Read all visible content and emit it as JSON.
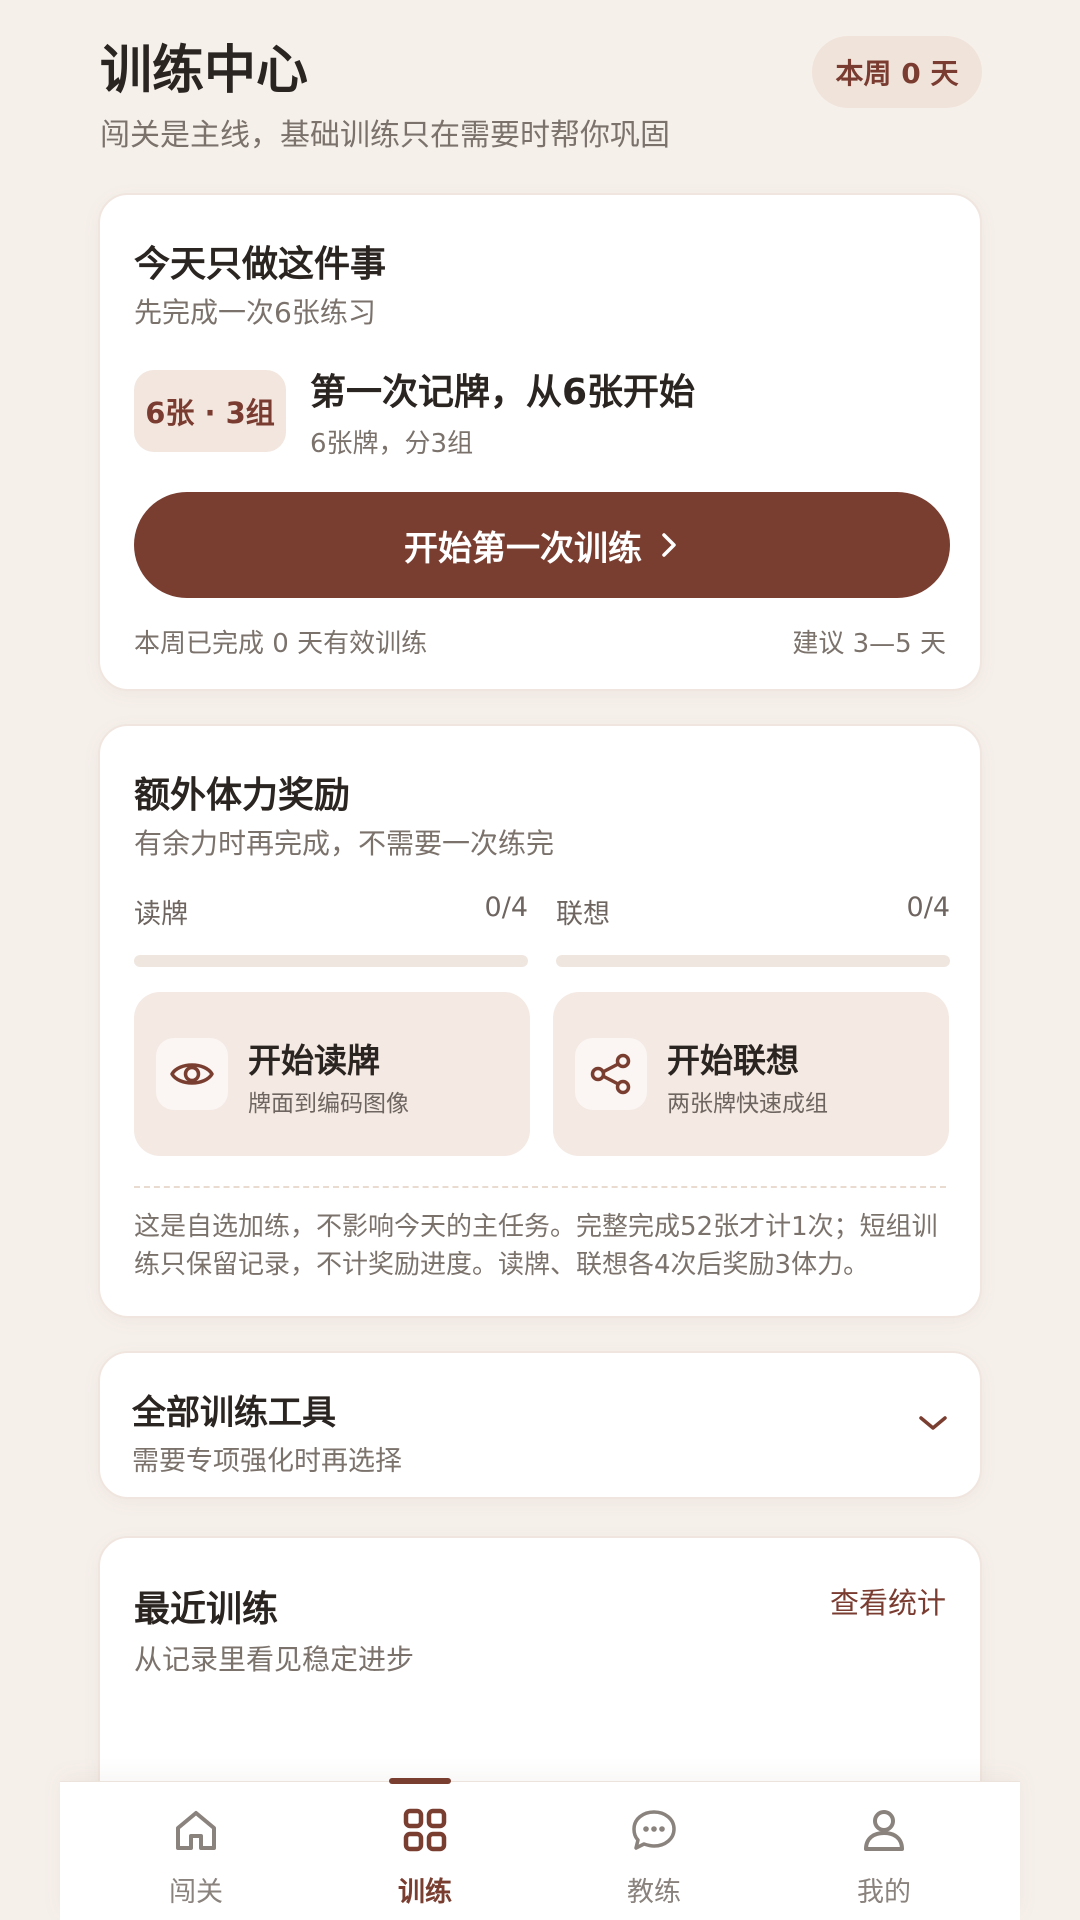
{
  "header": {
    "title": "训练中心",
    "subtitle": "闯关是主线，基础训练只在需要时帮你巩固",
    "week_badge": "本周 0 天"
  },
  "today": {
    "title": "今天只做这件事",
    "subtitle": "先完成一次6张练习",
    "chip": "6张 · 3组",
    "task_title": "第一次记牌，从6张开始",
    "task_subtitle": "6张牌，分3组",
    "start_button": "开始第一次训练",
    "footer_left": "本周已完成 0 天有效训练",
    "footer_right": "建议 3—5 天"
  },
  "bonus": {
    "title": "额外体力奖励",
    "subtitle": "有余力时再完成，不需要一次练完",
    "progress": [
      {
        "label": "读牌",
        "value": "0/4",
        "fraction": 0
      },
      {
        "label": "联想",
        "value": "0/4",
        "fraction": 0
      }
    ],
    "actions": [
      {
        "title": "开始读牌",
        "subtitle": "牌面到编码图像",
        "icon": "eye-icon"
      },
      {
        "title": "开始联想",
        "subtitle": "两张牌快速成组",
        "icon": "share-icon"
      }
    ],
    "note": "这是自选加练，不影响今天的主任务。完整完成52张才计1次；短组训练只保留记录，不计奖励进度。读牌、联想各4次后奖励3体力。"
  },
  "tools": {
    "title": "全部训练工具",
    "subtitle": "需要专项强化时再选择"
  },
  "recent": {
    "title": "最近训练",
    "subtitle": "从记录里看见稳定进步",
    "stats_link": "查看统计"
  },
  "nav": {
    "items": [
      {
        "label": "闯关",
        "icon": "home-icon",
        "active": false
      },
      {
        "label": "训练",
        "icon": "grid-icon",
        "active": true
      },
      {
        "label": "教练",
        "icon": "chat-icon",
        "active": false
      },
      {
        "label": "我的",
        "icon": "user-icon",
        "active": false
      }
    ]
  },
  "colors": {
    "accent": "#7a3e31",
    "background": "#f6f0eb",
    "tile": "#f4e9e3",
    "muted_text": "#7b726c"
  }
}
